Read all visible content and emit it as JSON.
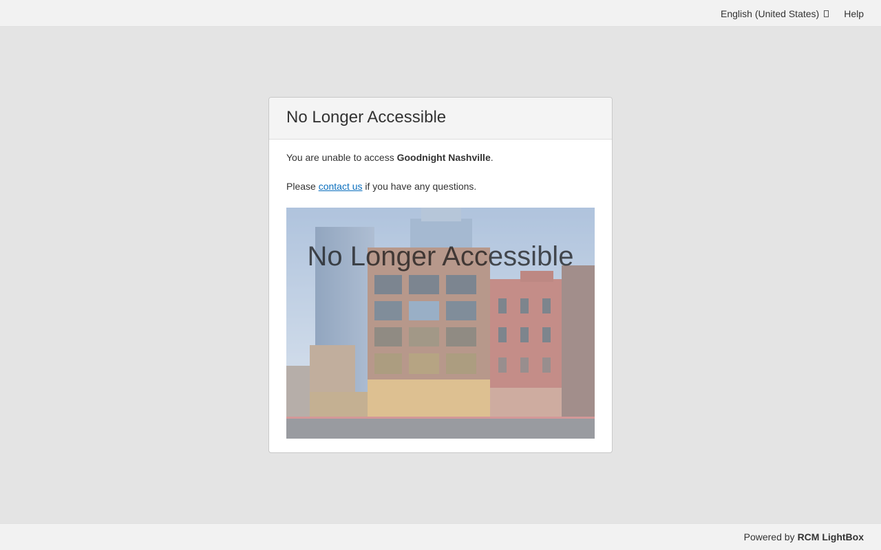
{
  "header": {
    "language": "English (United States)",
    "language_caret_icon": "dropdown-icon",
    "help": "Help"
  },
  "card": {
    "title": "No Longer Accessible",
    "line1_prefix": "You are unable to access ",
    "line1_entity": "Goodnight Nashville",
    "line1_suffix": ".",
    "line2_prefix": "Please ",
    "line2_link": "contact us",
    "line2_suffix": " if you have any questions.",
    "image_caption": "No Longer Accessible"
  },
  "footer": {
    "powered_by": "Powered by",
    "brand": "RCM LightBox"
  },
  "colors": {
    "page_background": "#e4e4e4",
    "bar_background": "#f2f2f2",
    "link": "#0a6ebd"
  }
}
